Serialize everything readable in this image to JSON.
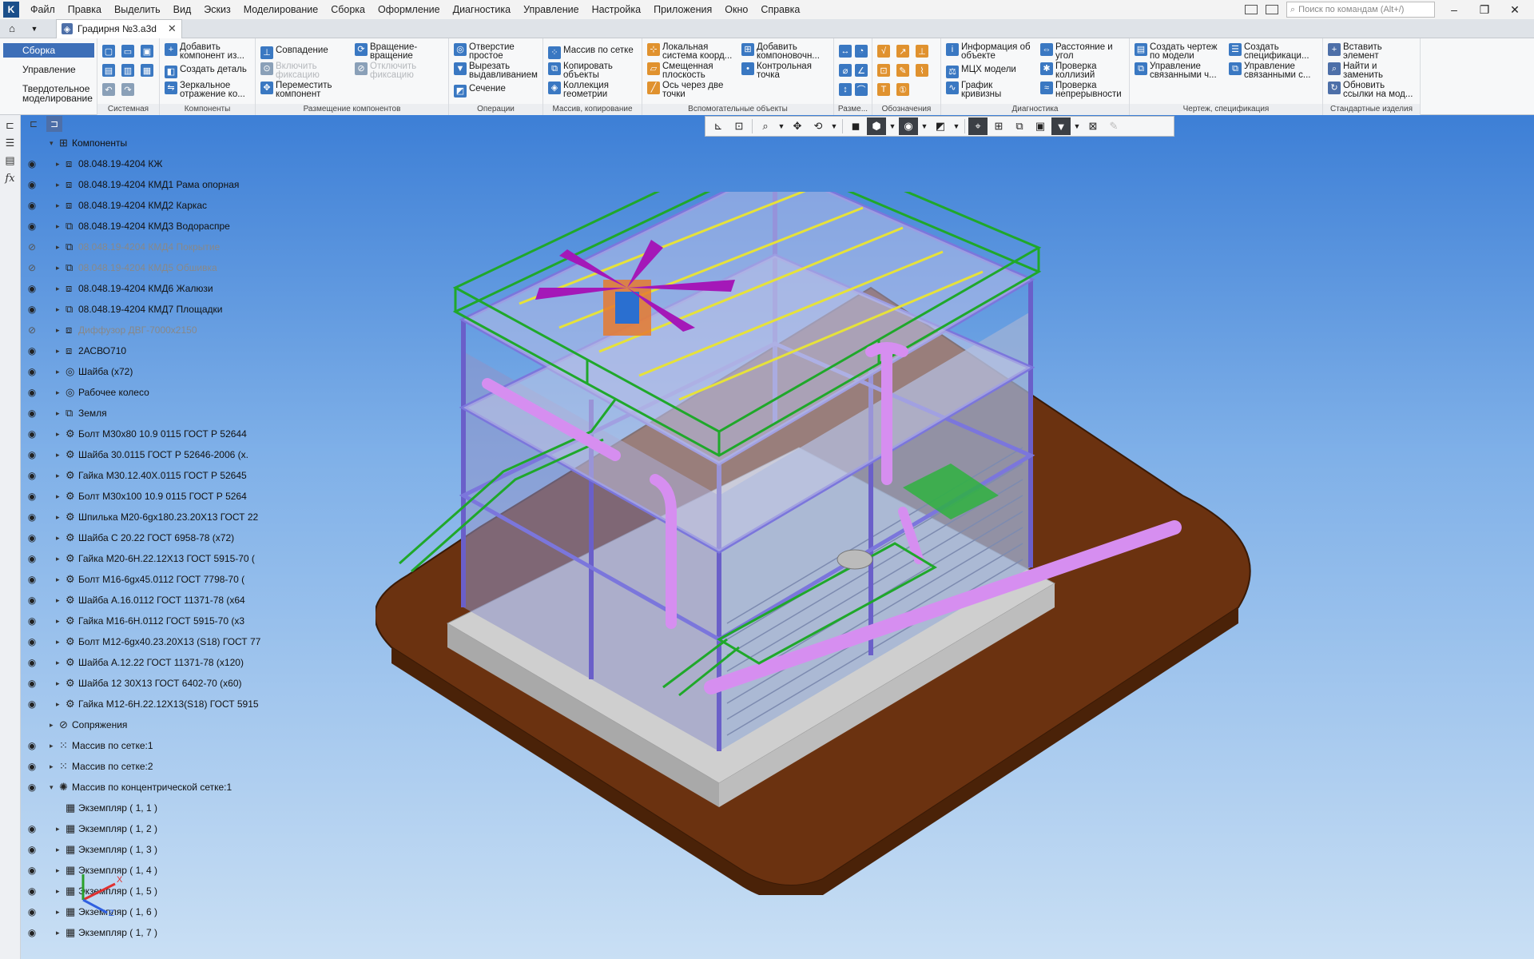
{
  "menubar": {
    "items": [
      "Файл",
      "Правка",
      "Выделить",
      "Вид",
      "Эскиз",
      "Моделирование",
      "Сборка",
      "Оформление",
      "Диагностика",
      "Управление",
      "Настройка",
      "Приложения",
      "Окно",
      "Справка"
    ],
    "search_placeholder": "Поиск по командам (Alt+/)"
  },
  "tabs": {
    "document": "Градирня №3.a3d"
  },
  "modes": {
    "assembly": "Сборка",
    "manage": "Управление",
    "solid": "Твердотельное\nмоделирование"
  },
  "ribbon": {
    "groups": [
      "Системная",
      "Компоненты",
      "Размещение компонентов",
      "Операции",
      "Массив, копирование",
      "Вспомогательные объекты",
      "Разме...",
      "Обозначения",
      "Диагностика",
      "Чертеж, спецификация",
      "Стандартные изделия"
    ],
    "buttons": {
      "add_component": "Добавить\nкомпонент из...",
      "create_part": "Создать деталь",
      "mirror": "Зеркальное\nотражение ко...",
      "coincide": "Совпадение",
      "enable_fix": "Включить\nфиксацию",
      "move_component": "Переместить\nкомпонент",
      "rotation": "Вращение-\nвращение",
      "disable_fix": "Отключить\nфиксацию",
      "hole": "Отверстие\nпростое",
      "extrude_cut": "Вырезать\nвыдавливанием",
      "section": "Сечение",
      "grid_array": "Массив по сетке",
      "copy_objects": "Копировать\nобъекты",
      "geometry_collection": "Коллекция\nгеометрии",
      "local_cs": "Локальная\nсистема коорд...",
      "offset_plane": "Смещенная\nплоскость",
      "axis_two_points": "Ось через две\nточки",
      "add_layout": "Добавить\nкомпоновочн...",
      "control_point": "Контрольная\nточка",
      "object_info": "Информация об\nобъекте",
      "mcs": "МЦХ модели",
      "curvature_graph": "График\nкривизны",
      "distance_angle": "Расстояние и\nугол",
      "collision_check": "Проверка\nколлизий",
      "continuity_check": "Проверка\nнепрерывности",
      "create_drawing": "Создать чертеж\nпо модели",
      "manage_linked1": "Управление\nсвязанными ч...",
      "create_spec": "Создать\nспецификаци...",
      "manage_linked2": "Управление\nсвязанными с...",
      "insert_element": "Вставить\nэлемент",
      "find_replace": "Найти и\nзаменить",
      "update_links": "Обновить\nссылки на мод..."
    }
  },
  "tree": {
    "rows": [
      {
        "label": "Компоненты",
        "level": 0,
        "expanded": true,
        "eye": "none",
        "icon": "folder"
      },
      {
        "label": "08.048.19-4204 КЖ",
        "level": 1,
        "eye": "on",
        "icon": "asm"
      },
      {
        "label": "08.048.19-4204 КМД1 Рама опорная",
        "level": 1,
        "eye": "on",
        "icon": "asm"
      },
      {
        "label": "08.048.19-4204 КМД2 Каркас",
        "level": 1,
        "eye": "on",
        "icon": "asm"
      },
      {
        "label": "08.048.19-4204 КМД3 Водораспре",
        "level": 1,
        "eye": "on",
        "icon": "asm2"
      },
      {
        "label": "08.048.19-4204 КМД4 Покрытие",
        "level": 1,
        "eye": "off",
        "icon": "asm2",
        "hidden": true
      },
      {
        "label": "08.048.19-4204 КМД5 Обшивка",
        "level": 1,
        "eye": "off",
        "icon": "asm2",
        "hidden": true
      },
      {
        "label": "08.048.19-4204 КМД6 Жалюзи",
        "level": 1,
        "eye": "on",
        "icon": "asm"
      },
      {
        "label": "08.048.19-4204 КМД7 Площадки",
        "level": 1,
        "eye": "on",
        "icon": "asm2"
      },
      {
        "label": "Диффузор ДВГ-7000х2150",
        "level": 1,
        "eye": "off",
        "icon": "asm",
        "hidden": true
      },
      {
        "label": "2АСВО710",
        "level": 1,
        "eye": "on",
        "icon": "asm"
      },
      {
        "label": "Шайба (x72)",
        "level": 1,
        "eye": "on",
        "icon": "part"
      },
      {
        "label": "Рабочее колесо",
        "level": 1,
        "eye": "on",
        "icon": "part"
      },
      {
        "label": "Земля",
        "level": 1,
        "eye": "on",
        "icon": "asm2"
      },
      {
        "label": "Болт М30х80 10.9 0115 ГОСТ Р 52644",
        "level": 1,
        "eye": "on",
        "icon": "std"
      },
      {
        "label": "Шайба 30.0115 ГОСТ Р 52646-2006 (x.",
        "level": 1,
        "eye": "on",
        "icon": "std"
      },
      {
        "label": "Гайка М30.12.40Х.0115 ГОСТ Р 52645",
        "level": 1,
        "eye": "on",
        "icon": "std"
      },
      {
        "label": "Болт М30х100 10.9 0115 ГОСТ Р 5264",
        "level": 1,
        "eye": "on",
        "icon": "std"
      },
      {
        "label": "Шпилька М20-6gх180.23.20Х13 ГОСТ 22",
        "level": 1,
        "eye": "on",
        "icon": "std"
      },
      {
        "label": "Шайба С 20.22 ГОСТ 6958-78 (x72)",
        "level": 1,
        "eye": "on",
        "icon": "std"
      },
      {
        "label": "Гайка М20-6Н.22.12Х13 ГОСТ 5915-70 (",
        "level": 1,
        "eye": "on",
        "icon": "std"
      },
      {
        "label": "Болт М16-6gх45.0112 ГОСТ 7798-70 (",
        "level": 1,
        "eye": "on",
        "icon": "std"
      },
      {
        "label": "Шайба А.16.0112 ГОСТ 11371-78 (x64",
        "level": 1,
        "eye": "on",
        "icon": "std"
      },
      {
        "label": "Гайка М16-6Н.0112 ГОСТ 5915-70 (x3",
        "level": 1,
        "eye": "on",
        "icon": "std"
      },
      {
        "label": "Болт М12-6gх40.23.20Х13 (S18) ГОСТ 77",
        "level": 1,
        "eye": "on",
        "icon": "std"
      },
      {
        "label": "Шайба А.12.22 ГОСТ 11371-78 (x120)",
        "level": 1,
        "eye": "on",
        "icon": "std"
      },
      {
        "label": "Шайба 12 30Х13 ГОСТ 6402-70 (x60)",
        "level": 1,
        "eye": "on",
        "icon": "std"
      },
      {
        "label": "Гайка М12-6Н.22.12Х13(S18) ГОСТ 5915",
        "level": 1,
        "eye": "on",
        "icon": "std"
      },
      {
        "label": "Сопряжения",
        "level": 0,
        "eye": "none",
        "icon": "clip"
      },
      {
        "label": "Массив по сетке:1",
        "level": 0,
        "eye": "on",
        "icon": "grid"
      },
      {
        "label": "Массив по сетке:2",
        "level": 0,
        "eye": "on",
        "icon": "grid"
      },
      {
        "label": "Массив по концентрической сетке:1",
        "level": 0,
        "expanded": true,
        "eye": "on",
        "icon": "conc"
      },
      {
        "label": "Экземпляр ( 1, 1 )",
        "level": 1,
        "eye": "none",
        "icon": "inst",
        "noarrow": true
      },
      {
        "label": "Экземпляр ( 1, 2 )",
        "level": 1,
        "eye": "on",
        "icon": "inst"
      },
      {
        "label": "Экземпляр ( 1, 3 )",
        "level": 1,
        "eye": "on",
        "icon": "inst"
      },
      {
        "label": "Экземпляр ( 1, 4 )",
        "level": 1,
        "eye": "on",
        "icon": "inst"
      },
      {
        "label": "Экземпляр ( 1, 5 )",
        "level": 1,
        "eye": "on",
        "icon": "inst"
      },
      {
        "label": "Экземпляр ( 1, 6 )",
        "level": 1,
        "eye": "on",
        "icon": "inst"
      },
      {
        "label": "Экземпляр ( 1, 7 )",
        "level": 1,
        "eye": "on",
        "icon": "inst"
      }
    ]
  },
  "triad": {
    "x": "X",
    "z": "Z"
  },
  "colors": {
    "steel": "#8a8ee0",
    "rail": "#1fa82a",
    "pipe": "#d68ef0",
    "fan": "#a418b8",
    "ground": "#6b3210",
    "yellow": "#e6e23a",
    "orange": "#e67a2e"
  }
}
